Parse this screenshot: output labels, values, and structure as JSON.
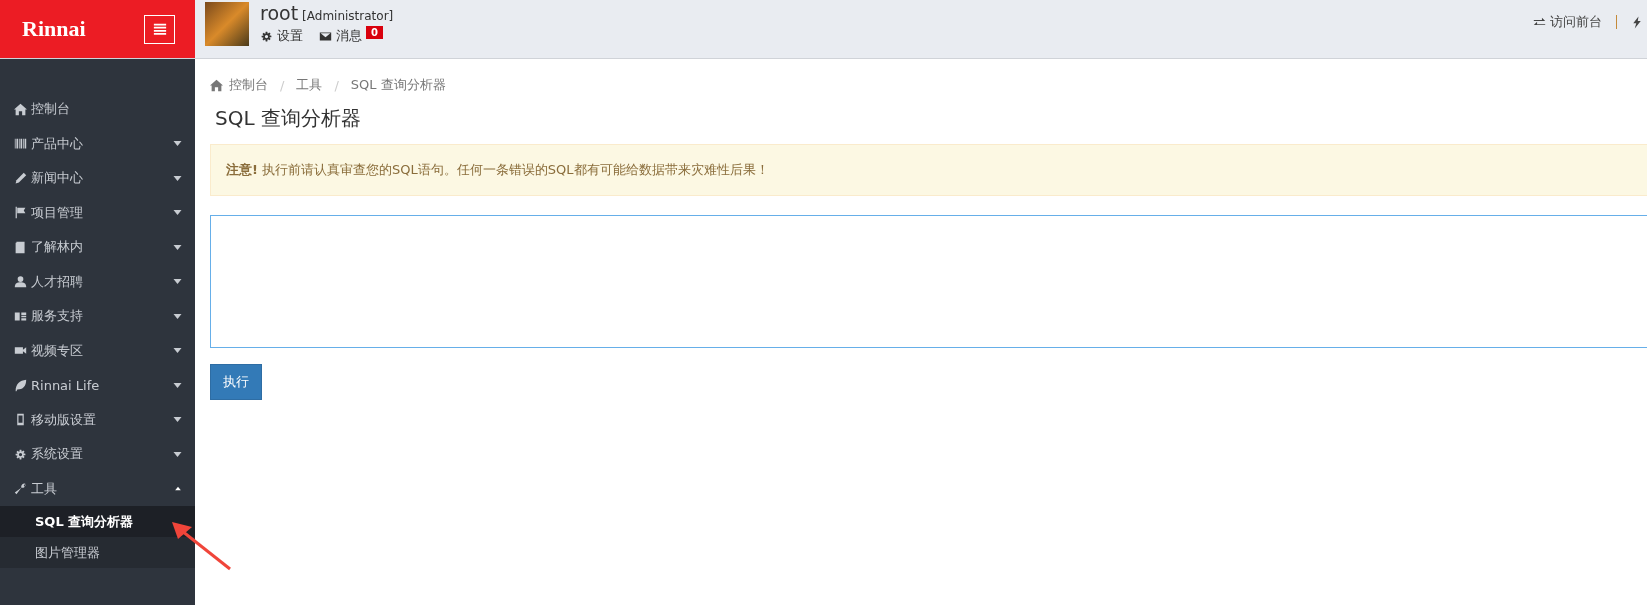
{
  "logo": "Rinnai",
  "user": {
    "name": "root",
    "role": "[Administrator]",
    "links": [
      {
        "kind": "settings",
        "label": "设置"
      },
      {
        "kind": "messages",
        "label": "消息",
        "badge": "0"
      }
    ]
  },
  "header_links": [
    {
      "label": "访问前台"
    }
  ],
  "sidebar": {
    "items": [
      {
        "label": "控制台"
      },
      {
        "label": "产品中心",
        "expanded": false
      },
      {
        "label": "新闻中心",
        "expanded": false
      },
      {
        "label": "项目管理",
        "expanded": false
      },
      {
        "label": "了解林内",
        "expanded": false
      },
      {
        "label": "人才招聘",
        "expanded": false
      },
      {
        "label": "服务支持",
        "expanded": false
      },
      {
        "label": "视频专区",
        "expanded": false
      },
      {
        "label": "Rinnai Life",
        "expanded": false
      },
      {
        "label": "移动版设置",
        "expanded": false
      },
      {
        "label": "系统设置",
        "expanded": false
      },
      {
        "label": "工具",
        "expanded": true,
        "children": [
          {
            "label": "SQL 查询分析器",
            "selected": true
          },
          {
            "label": "图片管理器",
            "selected": false
          }
        ]
      }
    ]
  },
  "breadcrumb": [
    {
      "label": "控制台"
    },
    {
      "separator": "/",
      "label": "工具"
    },
    {
      "separator": "/",
      "label": "SQL 查询分析器"
    }
  ],
  "title": "SQL 查询分析器",
  "alert": "**注意!** 执行前请认真审查您的SQL语句。任何一条错误的SQL都有可能给数据带来灾难性后果！",
  "button": "执行"
}
